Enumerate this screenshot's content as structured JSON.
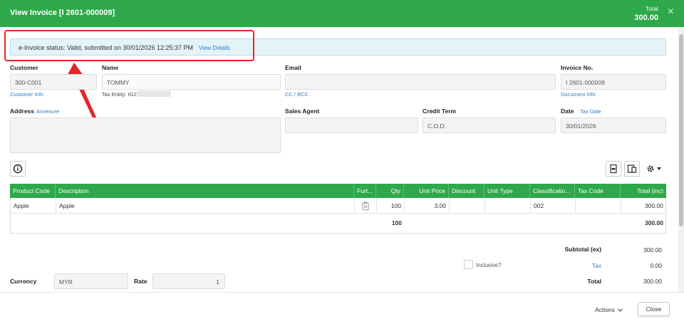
{
  "header": {
    "title": "View Invoice [I 2601-000009]",
    "total_label": "Total",
    "total_value": "300.00",
    "close": "×"
  },
  "banner": {
    "status_text": "e-Invoice status: Valid, submitted on 30/01/2026 12:25:37 PM",
    "link": "View Details"
  },
  "customer": {
    "label": "Customer",
    "value": "300-C001",
    "link": "Customer Info"
  },
  "name": {
    "label": "Name",
    "value": "TOMMY",
    "tax_entity": "Tax Entity: IG2"
  },
  "email": {
    "label": "Email",
    "value": "",
    "link": "CC / BCC"
  },
  "invoice_no": {
    "label": "Invoice No.",
    "value": "I 2601-000009",
    "link": "Document Info"
  },
  "address": {
    "label": "Address",
    "link": "Annexure",
    "value": ""
  },
  "sales_agent": {
    "label": "Sales Agent",
    "value": ""
  },
  "credit_term": {
    "label": "Credit Term",
    "value": "C.O.D."
  },
  "date": {
    "label": "Date",
    "link": "Tax Date",
    "value": "30/01/2026"
  },
  "table": {
    "columns": [
      "Product Code",
      "Description",
      "Furt...",
      "Qty",
      "Unit Price",
      "Discount",
      "Unit Type",
      "Classificatio...",
      "Tax Code",
      "Total (inc)"
    ],
    "rows": [
      {
        "product_code": "Apple",
        "description": "Apple",
        "qty": "100",
        "unit_price": "3.00",
        "discount": "",
        "unit_type": "",
        "classification": "002",
        "tax_code": "",
        "total": "300.00"
      }
    ],
    "qty_total": "100",
    "grand_total": "300.00"
  },
  "summary": {
    "subtotal_label": "Subtotal (ex)",
    "subtotal_value": "300.00",
    "inclusive_label": "Inclusive?",
    "tax_label": "Tax",
    "tax_value": "0.00",
    "total_label": "Total",
    "total_value": "300.00"
  },
  "currency": {
    "label": "Currency",
    "value": "MYR",
    "rate_label": "Rate",
    "rate_value": "1"
  },
  "footer": {
    "actions_label": "Actions",
    "close_label": "Close"
  },
  "colors": {
    "header_green": "#2ea84a",
    "link_blue": "#2a7bc8",
    "highlight_red": "#e3262a",
    "banner_bg": "#e3f3f7"
  }
}
